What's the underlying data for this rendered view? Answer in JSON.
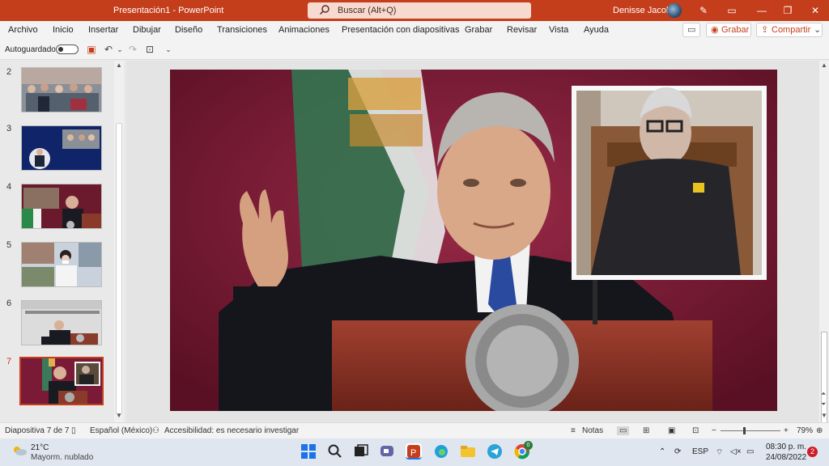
{
  "window": {
    "title": "Presentación1  -  PowerPoint",
    "search_placeholder": "Buscar (Alt+Q)",
    "user_name": "Denisse Jacobo"
  },
  "menu": [
    "Archivo",
    "Inicio",
    "Insertar",
    "Dibujar",
    "Diseño",
    "Transiciones",
    "Animaciones",
    "Presentación con diapositivas",
    "Grabar",
    "Revisar",
    "Vista",
    "Ayuda"
  ],
  "ribbon_buttons": {
    "record_label": "Grabar",
    "share_label": "Compartir"
  },
  "quick_access": {
    "autosave_label": "Autoguardado",
    "autosave_on": false
  },
  "thumbnails": [
    {
      "number": "2",
      "active": false
    },
    {
      "number": "3",
      "active": false
    },
    {
      "number": "4",
      "active": false
    },
    {
      "number": "5",
      "active": false
    },
    {
      "number": "6",
      "active": false
    },
    {
      "number": "7",
      "active": true
    }
  ],
  "status": {
    "slide_info": "Diapositiva 7 de 7",
    "language": "Español (México)",
    "accessibility": "Accesibilidad: es necesario investigar",
    "notes_label": "Notas",
    "zoom": "79%"
  },
  "taskbar": {
    "weather_temp": "21°C",
    "weather_desc": "Mayorm. nublado",
    "lang": "ESP",
    "time": "08:30 p. m.",
    "date": "24/08/2022",
    "notification_count": "2",
    "whatsapp_badge": "0"
  },
  "colors": {
    "accent": "#c43e1c",
    "slide_bg": "#7a1a36"
  }
}
